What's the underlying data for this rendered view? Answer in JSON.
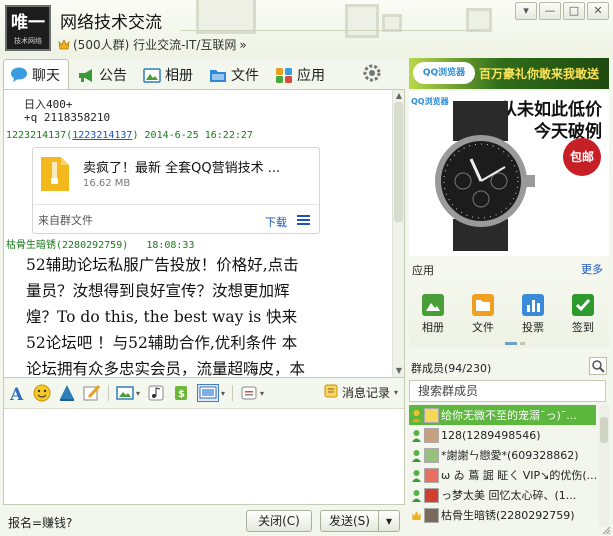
{
  "header": {
    "avatar_big": "唯一",
    "avatar_small": "技术网络",
    "group_name": "网络技术交流",
    "subtitle": "(500人群) 行业交流-IT/互联网",
    "subtitle_more": "»"
  },
  "tabs": [
    {
      "label": "聊天",
      "icon": "chat-bubble-icon"
    },
    {
      "label": "公告",
      "icon": "megaphone-icon"
    },
    {
      "label": "相册",
      "icon": "photo-icon"
    },
    {
      "label": "文件",
      "icon": "folder-icon"
    },
    {
      "label": "应用",
      "icon": "apps-icon"
    }
  ],
  "top_ad": {
    "logo": "QQ浏览器",
    "text": "百万豪礼你敢来我敢送"
  },
  "chat": {
    "lines": [
      "日入400+",
      "+q 2118358210"
    ],
    "msg1": {
      "id_prefix": "1223214137",
      "id_link": "1223214137",
      "time": "2014-6-25 16:22:27"
    },
    "file": {
      "name": "卖疯了！最新 全套QQ营销技术 ...",
      "size": "16.62 MB",
      "source": "来自群文件",
      "download": "下载"
    },
    "msg2": {
      "sender": "枯骨生暗锈",
      "id": "(2280292759)",
      "time": "18:08:33"
    },
    "big_text": [
      "52辅助论坛私服广告投放！价格好,点击",
      "量员？汝想得到良好宣传？汝想更加辉",
      "煌？To do this, the best way is 快来",
      "52论坛吧 ！与52辅助合作,优利条件 本",
      "论坛拥有众多忠实会员，流量超嗨皮，本"
    ]
  },
  "toolbar": {
    "history": "消息记录"
  },
  "bottom": {
    "status": "报名=赚钱?",
    "close": "关闭(C)",
    "send": "发送(S)"
  },
  "side_ad": {
    "logo": "QQ浏览器",
    "line1": "从未如此低价",
    "line2": "今天破例",
    "badge": "包邮"
  },
  "apps": {
    "title": "应用",
    "more": "更多",
    "items": [
      {
        "label": "相册",
        "icon": "photo-icon",
        "color": "#4a9e3a"
      },
      {
        "label": "文件",
        "icon": "folder-icon",
        "color": "#f0a020"
      },
      {
        "label": "投票",
        "icon": "chart-icon",
        "color": "#3a8ad8"
      },
      {
        "label": "签到",
        "icon": "check-icon",
        "color": "#2e9a2e"
      }
    ]
  },
  "members": {
    "title": "群成员(94/230)",
    "search_placeholder": "搜索群成员",
    "list": [
      "给你无微不至的宠溺ˉっ)ˉ...",
      "128(1289498546)",
      "*謝謝ㄣ戀愛*(609328862)",
      "ω ゐ 蔦 誳 眐ㄑ VIP↘的优伤(...",
      "っ梦太美 回忆太心碎、(1...",
      "枯骨生暗锈(2280292759)"
    ]
  },
  "colors": {
    "accent_green": "#5db73f",
    "link_blue": "#1a55c0",
    "name_green": "#1a7a1a",
    "ad_red": "#c61f26"
  }
}
